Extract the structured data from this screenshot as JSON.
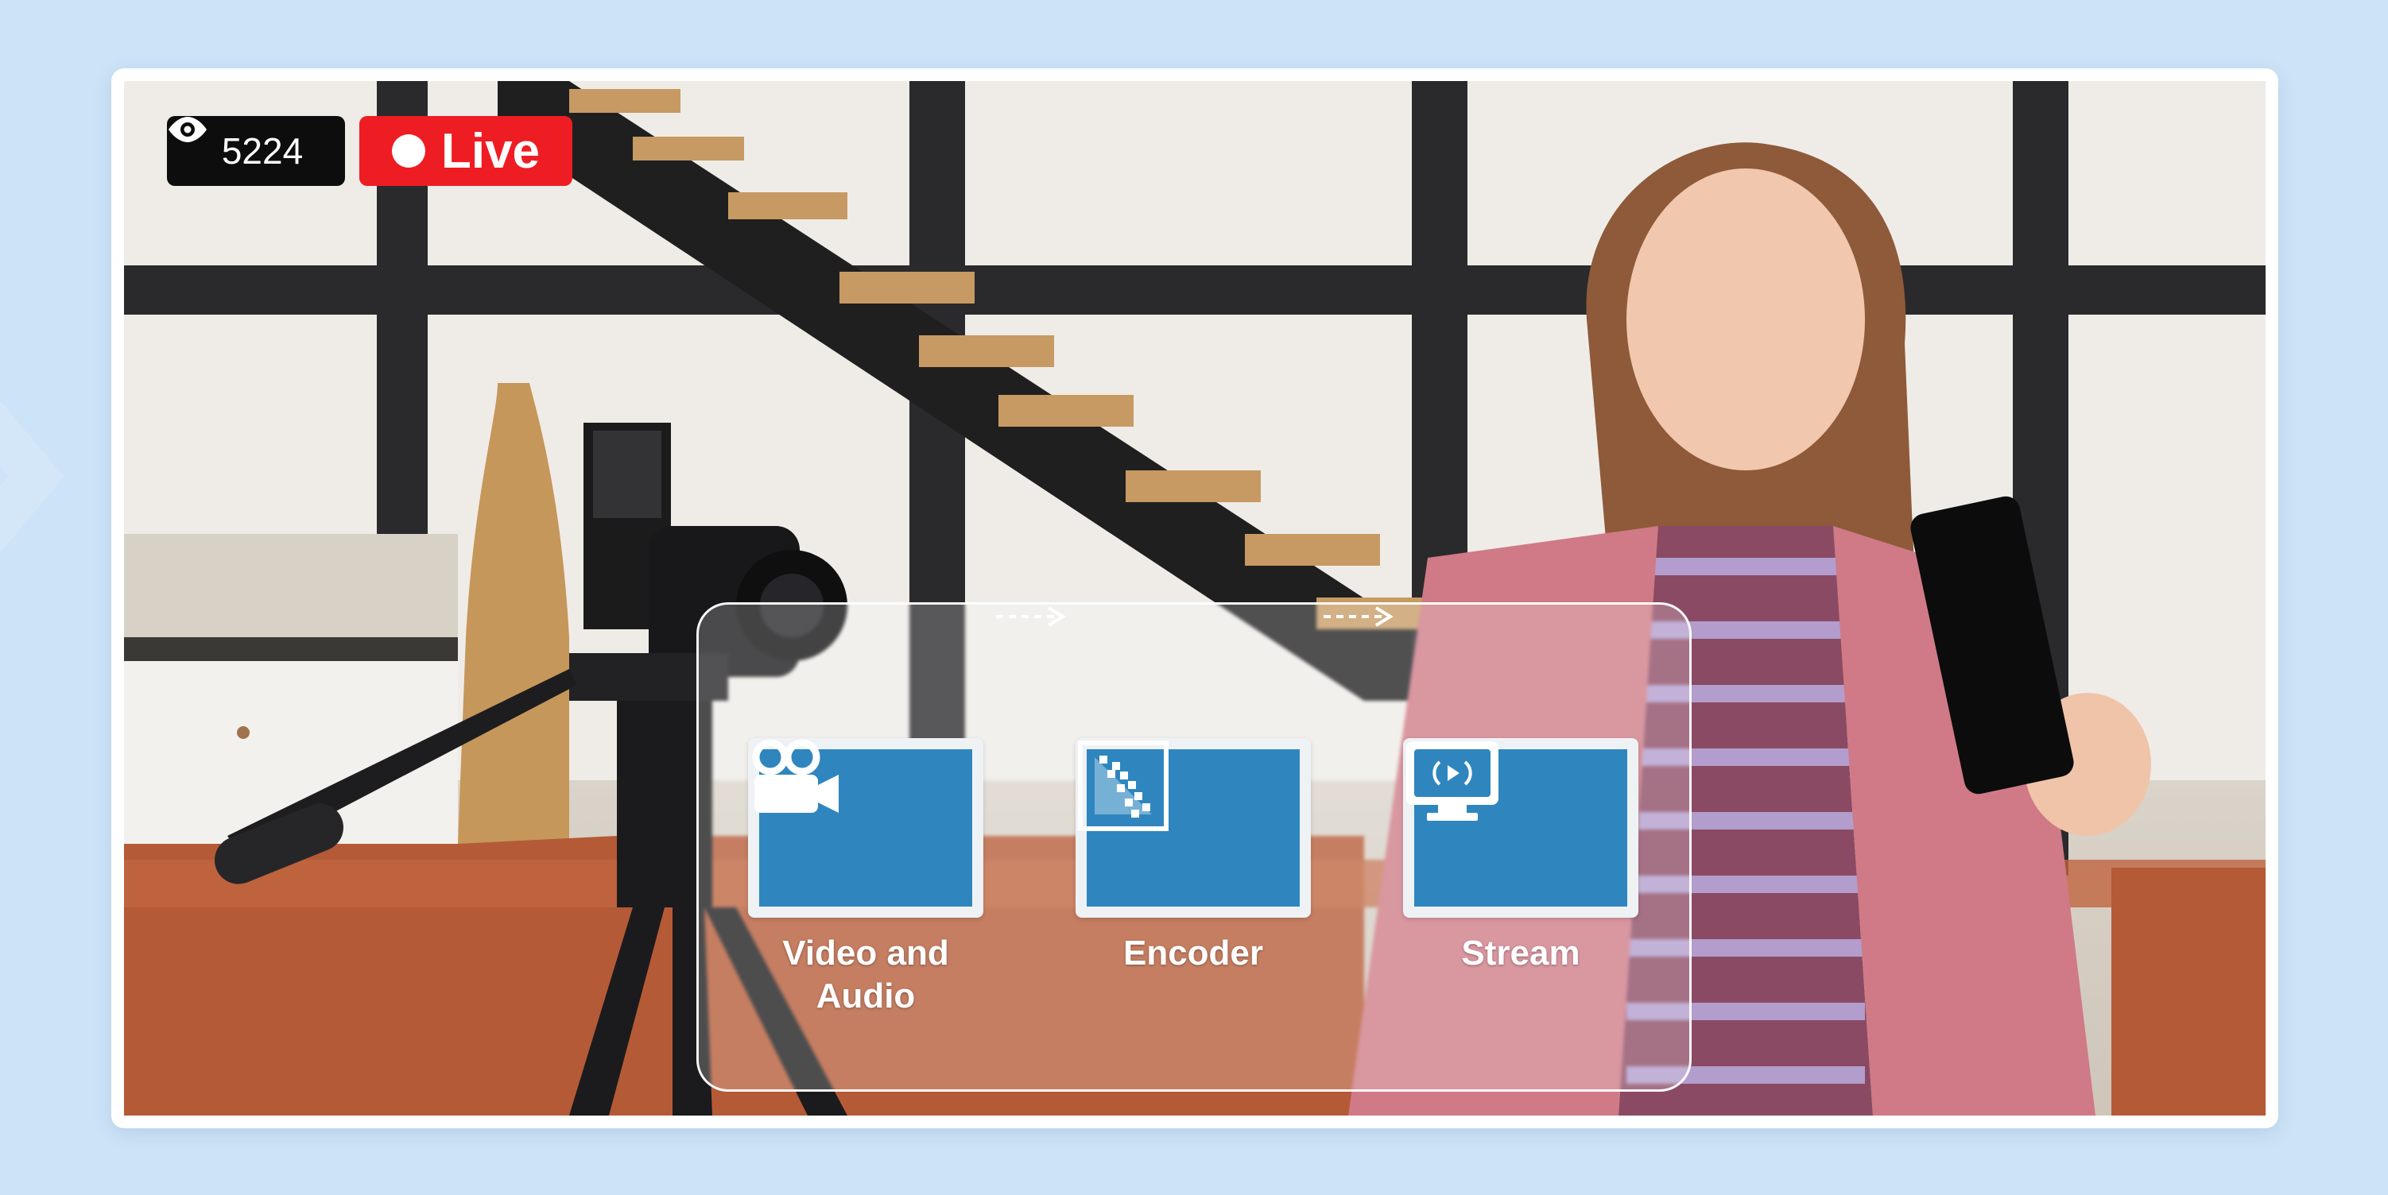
{
  "viewer_badge": {
    "icon": "eye-icon",
    "count": "5224"
  },
  "live_badge": {
    "label": "Live"
  },
  "pipeline": {
    "steps": [
      {
        "icon": "video-camera-icon",
        "label": "Video and Audio"
      },
      {
        "icon": "encoder-icon",
        "label": "Encoder"
      },
      {
        "icon": "stream-icon",
        "label": "Stream"
      }
    ]
  },
  "colors": {
    "page_background": "#cde3f7",
    "live_red": "#ee1d23",
    "step_blue": "#2f86bf"
  }
}
